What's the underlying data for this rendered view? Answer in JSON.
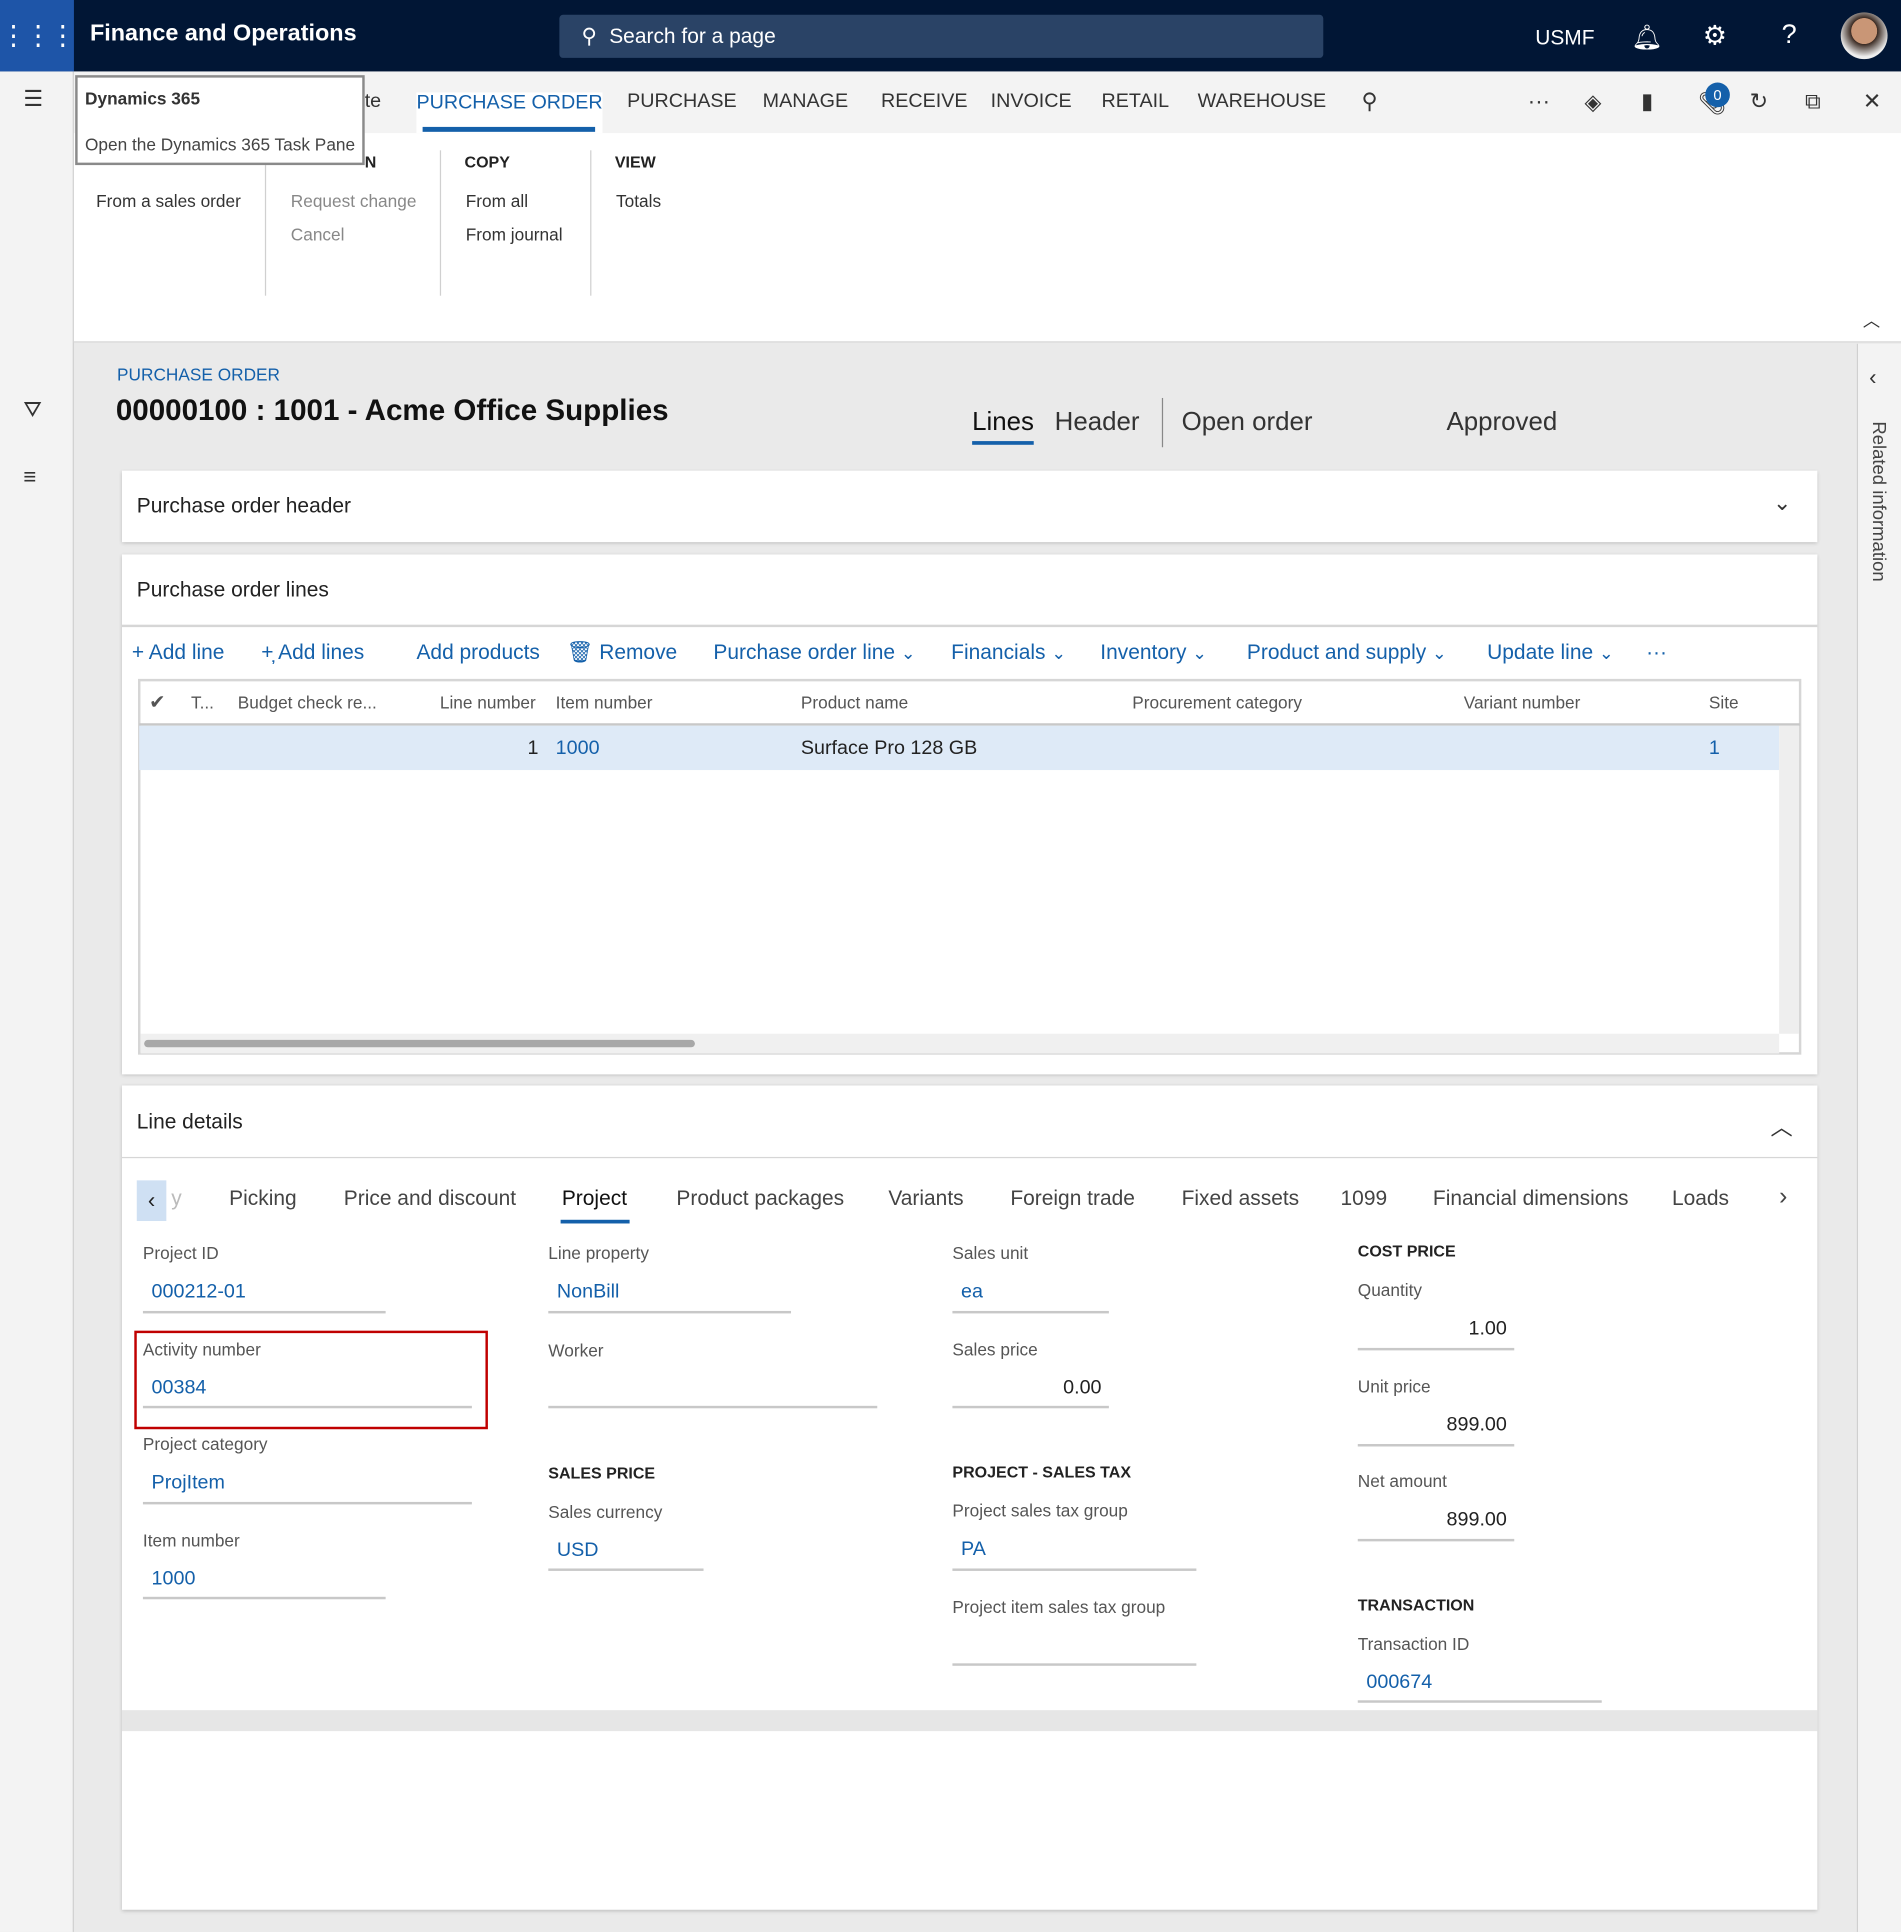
{
  "app": {
    "title": "Finance and Operations",
    "search_placeholder": "Search for a page",
    "company": "USMF",
    "attachments_count": "0"
  },
  "tooltip": {
    "title": "Dynamics 365",
    "text": "Open the Dynamics 365 Task Pane"
  },
  "nav": {
    "partial_tab": "te",
    "tabs": [
      "PURCHASE ORDER",
      "PURCHASE",
      "MANAGE",
      "RECEIVE",
      "INVOICE",
      "RETAIL",
      "WAREHOUSE"
    ],
    "active_tab": "PURCHASE ORDER"
  },
  "ribbon": {
    "groups": [
      {
        "title": "N",
        "items": [
          "From a sales order"
        ]
      },
      {
        "title": "",
        "items": [
          "Request change",
          "Cancel"
        ]
      },
      {
        "title": "COPY",
        "items": [
          "From all",
          "From journal"
        ]
      },
      {
        "title": "VIEW",
        "items": [
          "Totals"
        ]
      }
    ]
  },
  "page": {
    "breadcrumb": "PURCHASE ORDER",
    "title": "00000100 : 1001 - Acme Office Supplies",
    "view_tabs": [
      "Lines",
      "Header"
    ],
    "active_view": "Lines",
    "status1": "Open order",
    "status2": "Approved",
    "related_info": "Related information"
  },
  "header_section": {
    "title": "Purchase order header"
  },
  "lines_section": {
    "title": "Purchase order lines",
    "commands": [
      "Add line",
      "Add lines",
      "Add products",
      "Remove",
      "Purchase order line",
      "Financials",
      "Inventory",
      "Product and supply",
      "Update line"
    ],
    "columns": [
      "T...",
      "Budget check re...",
      "Line number",
      "Item number",
      "Product name",
      "Procurement category",
      "Variant number",
      "Site"
    ],
    "rows": [
      {
        "line_number": "1",
        "item_number": "1000",
        "product_name": "Surface Pro 128 GB",
        "procurement_category": "",
        "variant_number": "",
        "site": "1"
      }
    ]
  },
  "line_details": {
    "title": "Line details",
    "tabs": [
      "y",
      "Picking",
      "Price and discount",
      "Project",
      "Product packages",
      "Variants",
      "Foreign trade",
      "Fixed assets",
      "1099",
      "Financial dimensions",
      "Loads"
    ],
    "active_tab": "Project",
    "fields": {
      "project_id": {
        "label": "Project ID",
        "value": "000212-01"
      },
      "activity_number": {
        "label": "Activity number",
        "value": "00384"
      },
      "project_category": {
        "label": "Project category",
        "value": "ProjItem"
      },
      "item_number": {
        "label": "Item number",
        "value": "1000"
      },
      "line_property": {
        "label": "Line property",
        "value": "NonBill"
      },
      "worker": {
        "label": "Worker",
        "value": ""
      },
      "sales_price_section": "SALES PRICE",
      "sales_currency": {
        "label": "Sales currency",
        "value": "USD"
      },
      "sales_unit": {
        "label": "Sales unit",
        "value": "ea"
      },
      "sales_price": {
        "label": "Sales price",
        "value": "0.00"
      },
      "tax_section": "PROJECT - SALES TAX",
      "project_sales_tax_group": {
        "label": "Project sales tax group",
        "value": "PA"
      },
      "project_item_sales_tax_group": {
        "label": "Project item sales tax group",
        "value": ""
      },
      "cost_price_section": "COST PRICE",
      "quantity": {
        "label": "Quantity",
        "value": "1.00"
      },
      "unit_price": {
        "label": "Unit price",
        "value": "899.00"
      },
      "net_amount": {
        "label": "Net amount",
        "value": "899.00"
      },
      "transaction_section": "TRANSACTION",
      "transaction_id": {
        "label": "Transaction ID",
        "value": "000674"
      }
    }
  },
  "colors": {
    "topbar": "#011635",
    "accent": "#1460aa",
    "highlight_box": "#c00000",
    "selected_row": "#deeaf7"
  }
}
